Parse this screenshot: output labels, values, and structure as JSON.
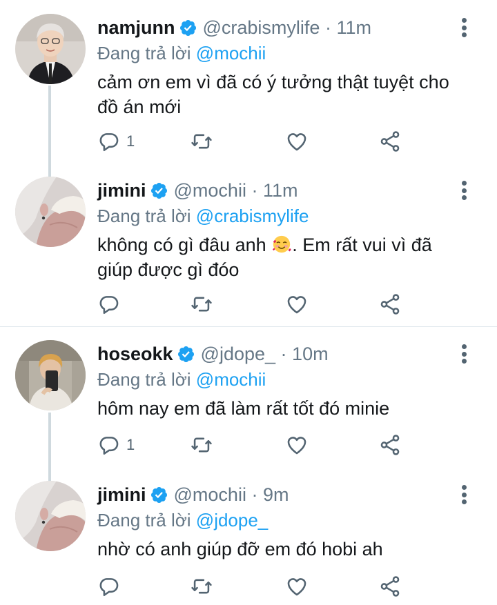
{
  "replying_prefix": "Đang trả lời",
  "tweets": [
    {
      "name": "namjunn",
      "handle": "@crabismylife",
      "time": "11m",
      "reply_to": "@mochii",
      "text": "cảm ơn em vì đã có ý tưởng thật tuyệt cho đồ án mới",
      "reply_count": "1"
    },
    {
      "name": "jimini",
      "handle": "@mochii",
      "time": "11m",
      "reply_to": "@crabismylife",
      "text_before_emoji": "không có gì đâu anh ",
      "emoji": "smiling-face-with-hearts",
      "text_after_emoji": ". Em rất vui vì đã giúp được gì đóo",
      "reply_count": ""
    },
    {
      "name": "hoseokk",
      "handle": "@jdope_",
      "time": "10m",
      "reply_to": "@mochii",
      "text": "hôm nay em đã làm rất tốt đó minie",
      "reply_count": "1"
    },
    {
      "name": "jimini",
      "handle": "@mochii",
      "time": "9m",
      "reply_to": "@jdope_",
      "text": "nhờ có anh giúp đỡ em đó hobi ah",
      "reply_count": ""
    }
  ],
  "colors": {
    "link": "#1da1f2",
    "verified": "#1da1f2",
    "muted": "#657786",
    "thread_line": "#cfd9de",
    "separator": "#e1e8ed"
  },
  "icons": [
    "verified-badge-icon",
    "more-options-icon",
    "reply-icon",
    "retweet-icon",
    "like-icon",
    "share-icon"
  ]
}
